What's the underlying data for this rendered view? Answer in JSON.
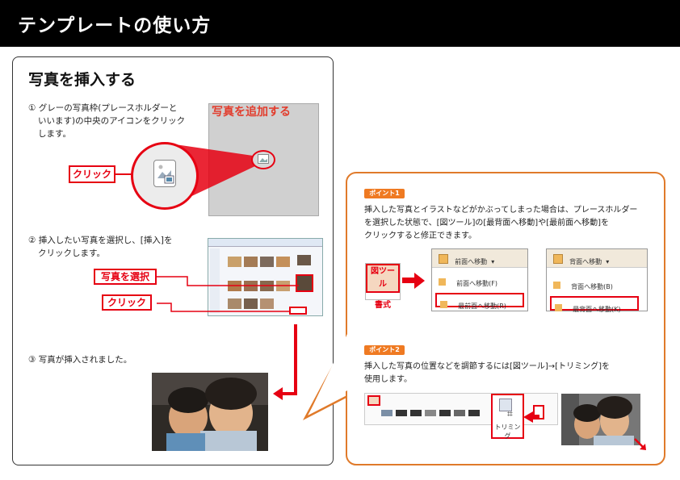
{
  "header": {
    "title": "テンプレートの使い方"
  },
  "left": {
    "heading": "写真を挿入する",
    "step1": [
      "① グレーの写真枠(プレースホルダーと",
      "いいます)の中央のアイコンをクリック",
      "します。"
    ],
    "add_photo_label": "写真を追加する",
    "click_label": "クリック",
    "step2": [
      "② 挿入したい写真を選択し、[挿入]を",
      "クリックします。"
    ],
    "select_photo_label": "写真を選択",
    "click_label2": "クリック",
    "step3": "③ 写真が挿入されました。"
  },
  "point1": {
    "badge": "ポイント1",
    "text": [
      "挿入した写真とイラストなどがかぶってしまった場合は、プレースホルダー",
      "を選択した状態で、[図ツール]の[最背面へ移動]や[最前面へ移動]を",
      "クリックすると修正できます。"
    ],
    "tool_label": "図ツール",
    "format_label": "書式",
    "ribbon1": {
      "head": "前面へ移動",
      "item1": "前面へ移動(F)",
      "item2": "最前面へ移動(R)"
    },
    "ribbon2": {
      "head": "背面へ移動",
      "item1": "背面へ移動(B)",
      "item2": "最背面へ移動(K)"
    }
  },
  "point2": {
    "badge": "ポイント2",
    "text": [
      "挿入した写真の位置などを調節するには[図ツール]→[トリミング]を",
      "使用します。"
    ],
    "trim_label": "トリミング"
  },
  "colors": {
    "accent_red": "#e60012",
    "orange": "#ef7a22",
    "header_bg": "#000000"
  }
}
